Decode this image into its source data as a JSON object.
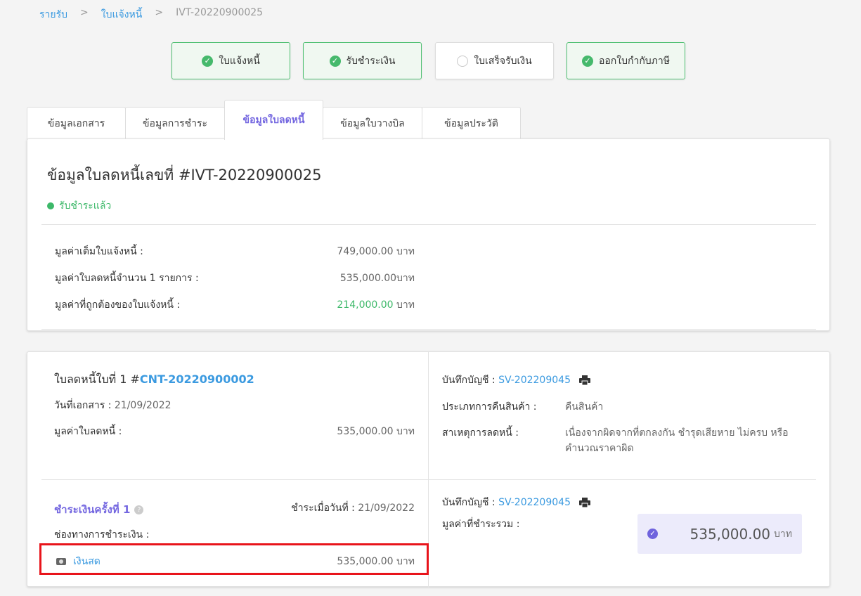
{
  "breadcrumb": {
    "items": [
      "รายรับ",
      "ใบแจ้งหนี้",
      "IVT-20220900025"
    ],
    "sep": ">"
  },
  "steps": [
    {
      "label": "ใบแจ้งหนี้",
      "done": true
    },
    {
      "label": "รับชำระเงิน",
      "done": true
    },
    {
      "label": "ใบเสร็จรับเงิน",
      "done": false
    },
    {
      "label": "ออกใบกำกับภาษี",
      "done": true
    }
  ],
  "tabs": [
    "ข้อมูลเอกสาร",
    "ข้อมูลการชำระ",
    "ข้อมูลใบลดหนี้",
    "ข้อมูลใบวางบิล",
    "ข้อมูลประวัติ"
  ],
  "summary": {
    "title": "ข้อมูลใบลดหนี้เลขที่ #IVT-20220900025",
    "status": "รับชำระแล้ว",
    "full_label": "มูลค่าเต็มใบแจ้งหนี้ :",
    "full_value": "749,000.00 บาท",
    "credit_label": "มูลค่าใบลดหนี้จำนวน 1 รายการ :",
    "credit_value": "535,000.00บาท",
    "correct_label": "มูลค่าที่ถูกต้องของใบแจ้งหนี้ :",
    "correct_value": "214,000.00",
    "correct_unit": "บาท"
  },
  "credit_note": {
    "title_prefix": "ใบลดหนี้ใบที่ 1 #",
    "number": "CNT-20220900002",
    "doc_date_label": "วันที่เอกสาร :",
    "doc_date": "21/09/2022",
    "value_label": "มูลค่าใบลดหนี้ :",
    "value": "535,000.00 บาท",
    "account_label": "บันทึกบัญชี :",
    "account": "SV-202209045",
    "return_type_label": "ประเภทการคืนสินค้า :",
    "return_type": "คืนสินค้า",
    "reason_label": "สาเหตุการลดหนี้ :",
    "reason_line1": "เนื่องจากผิดจากที่ตกลงกัน ชำรุดเสียหาย ไม่ครบ หรือ",
    "reason_line2": "คำนวณราคาผิด"
  },
  "payment": {
    "title": "ชำระเงินครั้งที่ 1",
    "help_icon": "?",
    "date_label": "ชำระเมื่อวันที่ :",
    "date": "21/09/2022",
    "channel_label": "ช่องทางการชำระเงิน :",
    "method": "เงินสด",
    "method_value": "535,000.00 บาท",
    "account_label": "บันทึกบัญชี :",
    "account": "SV-202209045",
    "total_label": "มูลค่าที่ชำระรวม :",
    "total": "535,000.00",
    "total_unit": "บาท"
  },
  "colors": {
    "accent": "#7467e0",
    "success": "#3db869",
    "link": "#3b9ae0",
    "highlight": "#e8141b"
  }
}
